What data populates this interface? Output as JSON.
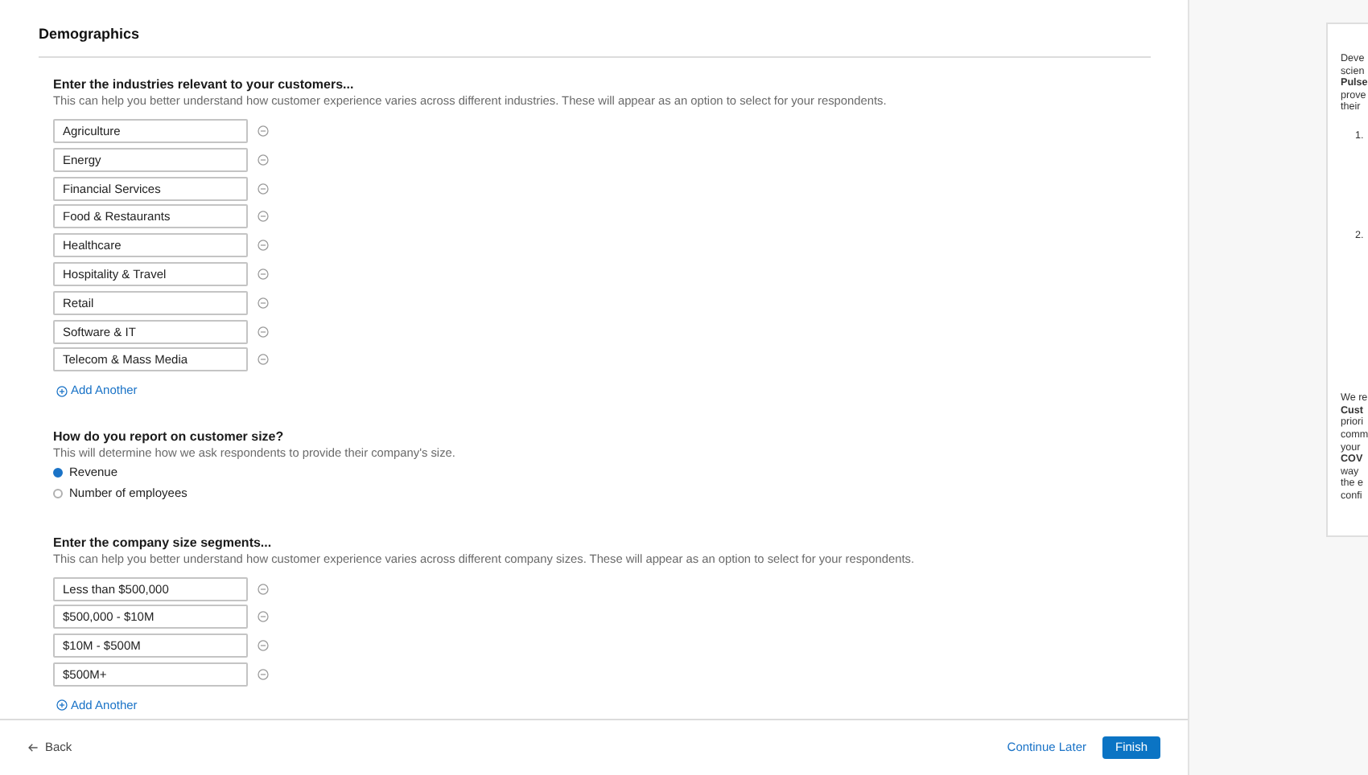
{
  "heading": "Demographics",
  "industries": {
    "title": "Enter the industries relevant to your customers...",
    "description": "This can help you better understand how customer experience varies across different industries. These will appear as an option to select for your respondents.",
    "values": [
      "Agriculture",
      "Energy",
      "Financial Services",
      "Food & Restaurants",
      "Healthcare",
      "Hospitality & Travel",
      "Retail",
      "Software & IT",
      "Telecom & Mass Media"
    ],
    "add_label": "Add Another"
  },
  "customer_size": {
    "title": "How do you report on customer size?",
    "description": "This will determine how we ask respondents to provide their company's size.",
    "options": [
      {
        "label": "Revenue",
        "selected": true
      },
      {
        "label": "Number of employees",
        "selected": false
      }
    ]
  },
  "size_segments": {
    "title": "Enter the company size segments...",
    "description": "This can help you better understand how customer experience varies across different company sizes. These will appear as an option to select for your respondents.",
    "values": [
      "Less than $500,000",
      "$500,000 - $10M",
      "$10M - $500M",
      "$500M+"
    ],
    "add_label": "Add Another"
  },
  "footer": {
    "back": "Back",
    "continue_later": "Continue Later",
    "finish": "Finish"
  },
  "side_panel": {
    "paragraph_1": [
      {
        "text": "Deve",
        "bold": false
      },
      {
        "text": "scien",
        "bold": false
      },
      {
        "text": "Pulse",
        "bold": true
      },
      {
        "text": "prove",
        "bold": false
      },
      {
        "text": "their",
        "bold": false
      }
    ],
    "list_numbers": [
      "1.",
      "2."
    ],
    "paragraph_2": [
      {
        "text": "We re",
        "bold": false
      },
      {
        "text": "Cust",
        "bold": true
      },
      {
        "text": "priori",
        "bold": false
      },
      {
        "text": "comm",
        "bold": false
      },
      {
        "text": "your",
        "bold": false
      },
      {
        "text": "COV",
        "bold": true
      },
      {
        "text": "way",
        "bold": false
      },
      {
        "text": "the e",
        "bold": false
      },
      {
        "text": "confi",
        "bold": false
      }
    ]
  }
}
